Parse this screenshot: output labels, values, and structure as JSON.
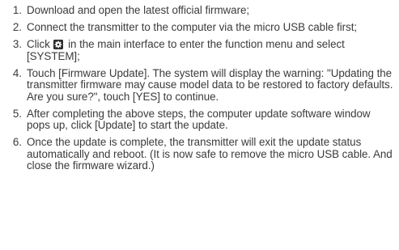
{
  "steps": [
    {
      "number": "1",
      "text": "Download and open the latest official firmware;"
    },
    {
      "number": "2",
      "text": "Connect the transmitter to the computer via the micro USB cable first;"
    },
    {
      "number": "3",
      "text_before_icon": "Click",
      "icon": "settings-gear-icon",
      "text_after_icon": "in the main interface to enter the function menu and select [SYSTEM];"
    },
    {
      "number": "4",
      "text": "Touch [Firmware Update]. The system will display the warning: \"Updating the transmitter firmware may cause model data to be restored to factory defaults. Are you sure?\", touch [YES] to continue."
    },
    {
      "number": "5",
      "text": "After completing the above steps, the computer update software window pops up, click [Update] to start the update."
    },
    {
      "number": "6",
      "text": "Once the update is complete, the transmitter will exit the update status automatically and reboot. (It is now safe to remove the micro USB cable. And close the firmware wizard.)"
    }
  ],
  "colors": {
    "text": "#3b3b3b",
    "icon": "#2b2b2b",
    "background": "#ffffff"
  }
}
